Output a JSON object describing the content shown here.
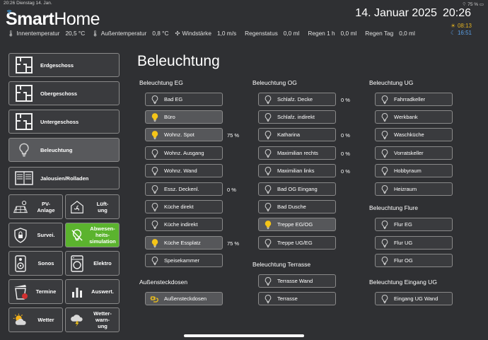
{
  "statusbar": {
    "left": "20:26  Dienstag 14. Jan.",
    "right": "75 %"
  },
  "header": {
    "logo_smart": "Smart",
    "logo_home": "Home",
    "date": "14. Januar 2025",
    "time": "20:26",
    "sunrise": "08:13",
    "sunset": "16:51"
  },
  "weather": {
    "indoor_label": "Innentemperatur",
    "indoor_value": "20,5 °C",
    "outdoor_label": "Außentemperatur",
    "outdoor_value": "0,8 °C",
    "wind_label": "Windstärke",
    "wind_value": "1,0 m/s",
    "rain_status_label": "Regenstatus",
    "rain_status_value": "0,0 ml",
    "rain_1h_label": "Regen 1 h",
    "rain_1h_value": "0,0 ml",
    "rain_day_label": "Regen Tag",
    "rain_day_value": "0,0 ml"
  },
  "nav": {
    "erdgeschoss": "Erdgeschoss",
    "obergeschoss": "Obergeschoss",
    "untergeschoss": "Untergeschoss",
    "beleuchtung": "Beleuchtung",
    "jalousien": "Jalousien/Rolladen",
    "pv_1": "PV-",
    "pv_2": "Anlage",
    "lueft_1": "Lüft-",
    "lueft_2": "ung",
    "survei": "Survei.",
    "abw_1": "Abwesen-",
    "abw_2": "heits-",
    "abw_3": "simulation",
    "sonos": "Sonos",
    "elektro": "Elektro",
    "termine": "Termine",
    "auswert": "Auswert.",
    "wetter": "Wetter",
    "ww_1": "Wetter-",
    "ww_2": "warn-",
    "ww_3": "ung"
  },
  "main": {
    "title": "Beleuchtung",
    "eg": {
      "title": "Beleuchtung EG",
      "items": [
        {
          "label": "Bad EG",
          "pct": ""
        },
        {
          "label": "Büro",
          "pct": ""
        },
        {
          "label": "Wohnz. Spot",
          "pct": "75 %"
        },
        {
          "label": "Wohnz. Ausgang",
          "pct": ""
        },
        {
          "label": "Wohnz. Wand",
          "pct": ""
        },
        {
          "label": "Essz. Deckenl.",
          "pct": "0 %"
        },
        {
          "label": "Küche direkt",
          "pct": ""
        },
        {
          "label": "Küche indirekt",
          "pct": ""
        },
        {
          "label": "Küche Essplatz",
          "pct": "75 %"
        },
        {
          "label": "Speisekammer",
          "pct": ""
        }
      ]
    },
    "aussen": {
      "title": "Außensteckdosen",
      "items": [
        {
          "label": "Außensteckdosen"
        }
      ]
    },
    "og": {
      "title": "Beleuchtung OG",
      "items": [
        {
          "label": "Schlafz. Decke",
          "pct": "0 %"
        },
        {
          "label": "Schlafz. indirekt",
          "pct": ""
        },
        {
          "label": "Katharina",
          "pct": "0 %"
        },
        {
          "label": "Maximilian rechts",
          "pct": "0 %"
        },
        {
          "label": "Maximilian links",
          "pct": "0 %"
        },
        {
          "label": "Bad OG Eingang",
          "pct": ""
        },
        {
          "label": "Bad Dusche",
          "pct": ""
        },
        {
          "label": "Treppe EG/OG",
          "pct": ""
        },
        {
          "label": "Treppe UG/EG",
          "pct": ""
        }
      ]
    },
    "terrasse": {
      "title": "Beleuchtung Terrasse",
      "items": [
        {
          "label": "Terrasse Wand"
        },
        {
          "label": "Terrasse"
        }
      ]
    },
    "ug": {
      "title": "Beleuchtung UG",
      "items": [
        {
          "label": "Fahrradkeller"
        },
        {
          "label": "Werkbank"
        },
        {
          "label": "Waschküche"
        },
        {
          "label": "Vorratskeller"
        },
        {
          "label": "Hobbyraum"
        },
        {
          "label": "Heizraum"
        }
      ]
    },
    "flure": {
      "title": "Beleuchtung Flure",
      "items": [
        {
          "label": "Flur EG"
        },
        {
          "label": "Flur UG"
        },
        {
          "label": "Flur OG"
        }
      ]
    },
    "eingang": {
      "title": "Beleuchtung Eingang UG",
      "items": [
        {
          "label": "Eingang UG Wand"
        }
      ]
    }
  },
  "colors": {
    "bulb_on": "#f5c518",
    "bulb_off": "#d0d0d0",
    "active_green": "#5bb32e",
    "background": "#2f3033"
  }
}
